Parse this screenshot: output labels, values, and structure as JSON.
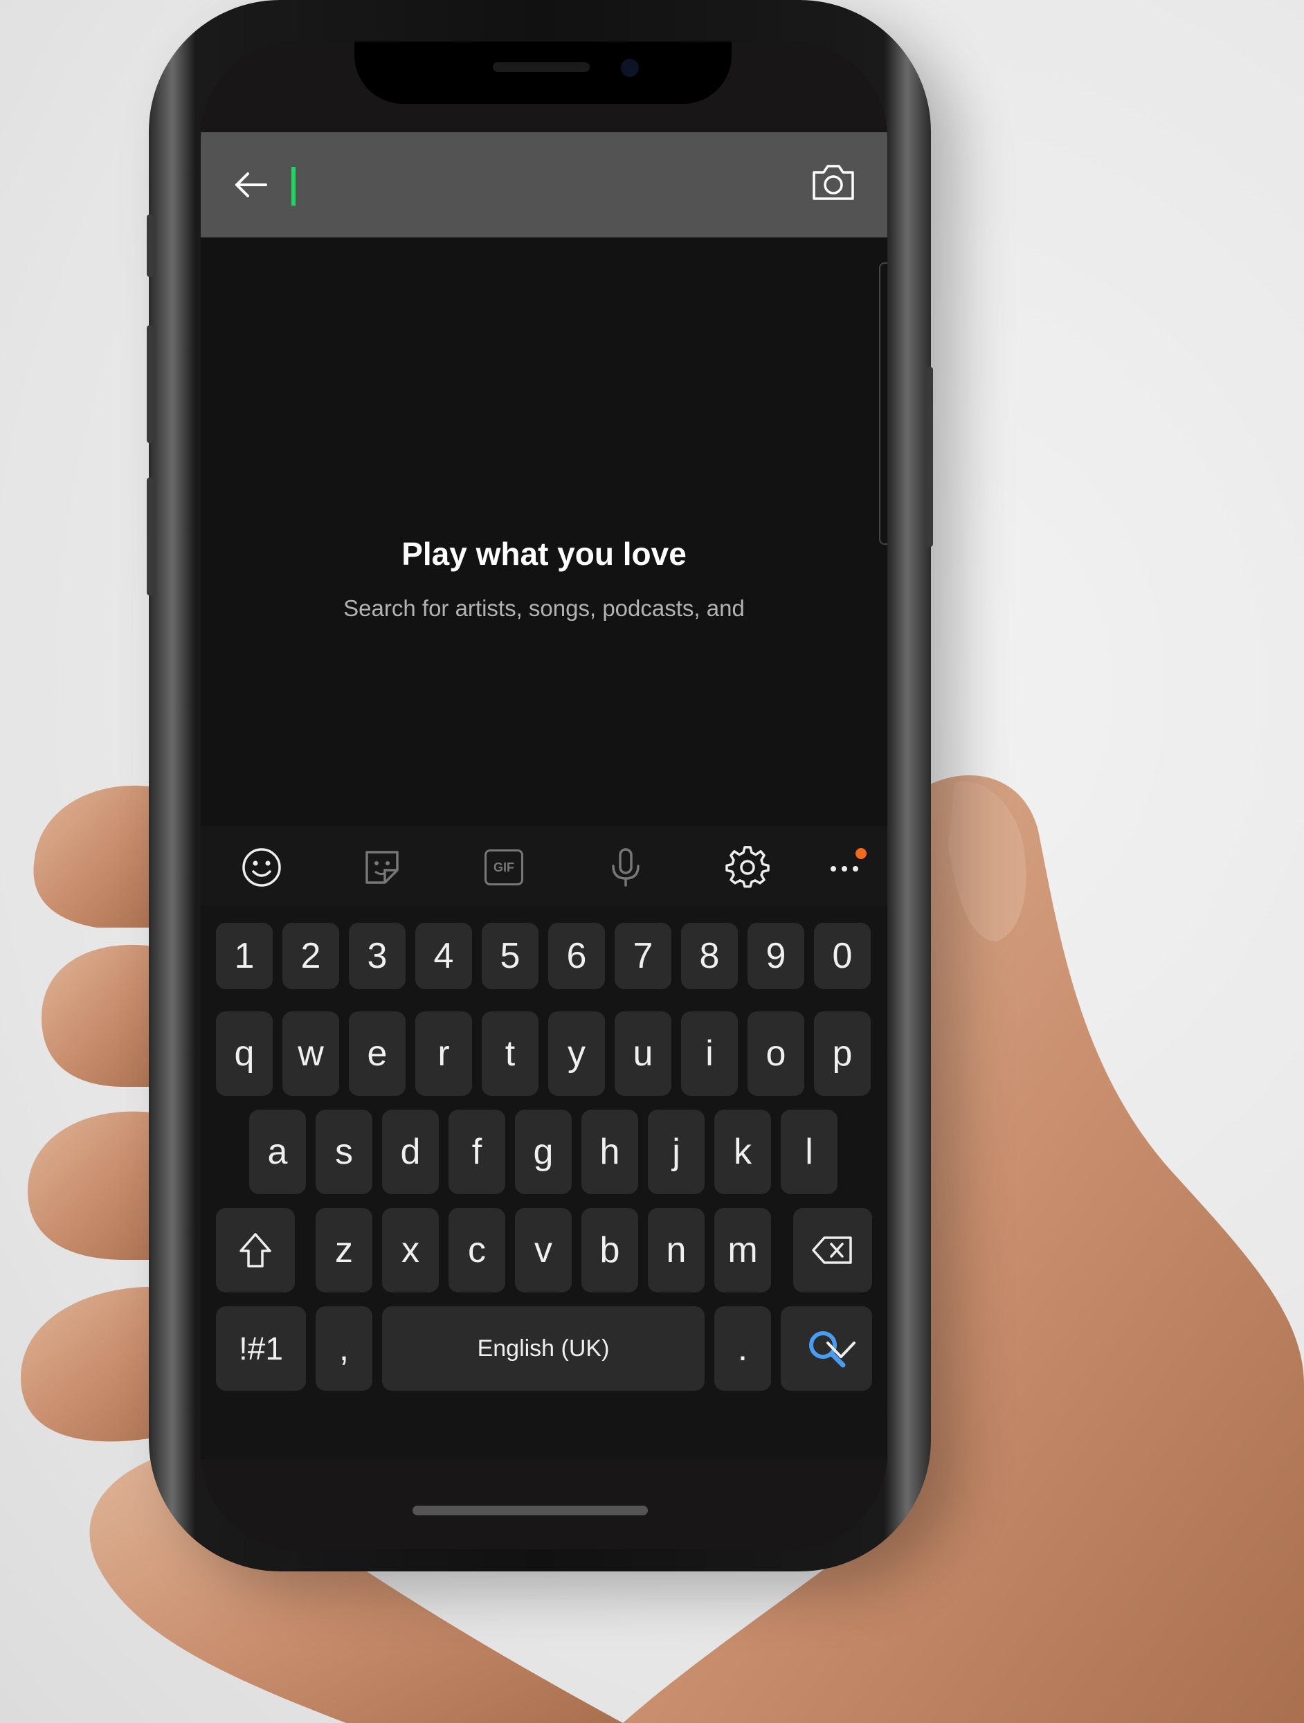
{
  "search": {
    "value": "",
    "placeholder": ""
  },
  "empty_state": {
    "headline": "Play what you love",
    "subtext": "Search for artists, songs, podcasts, and"
  },
  "keyboard": {
    "toolbar": [
      "emoji-icon",
      "sticker-icon",
      "gif-icon",
      "microphone-icon",
      "settings-gear-icon",
      "more-options-icon"
    ],
    "gif_label": "GIF",
    "number_row": [
      "1",
      "2",
      "3",
      "4",
      "5",
      "6",
      "7",
      "8",
      "9",
      "0"
    ],
    "row1": [
      "q",
      "w",
      "e",
      "r",
      "t",
      "y",
      "u",
      "i",
      "o",
      "p"
    ],
    "row2": [
      "a",
      "s",
      "d",
      "f",
      "g",
      "h",
      "j",
      "k",
      "l"
    ],
    "row3": [
      "z",
      "x",
      "c",
      "v",
      "b",
      "n",
      "m"
    ],
    "symbols_label": "!#1",
    "comma_label": ",",
    "space_label": "English (UK)",
    "period_label": ".",
    "search_key_color": "#4a9cf0",
    "badge_color": "#f26b1d"
  },
  "colors": {
    "accent_caret": "#1ed760",
    "search_bar_bg": "#535353",
    "screen_bg": "#121212"
  }
}
